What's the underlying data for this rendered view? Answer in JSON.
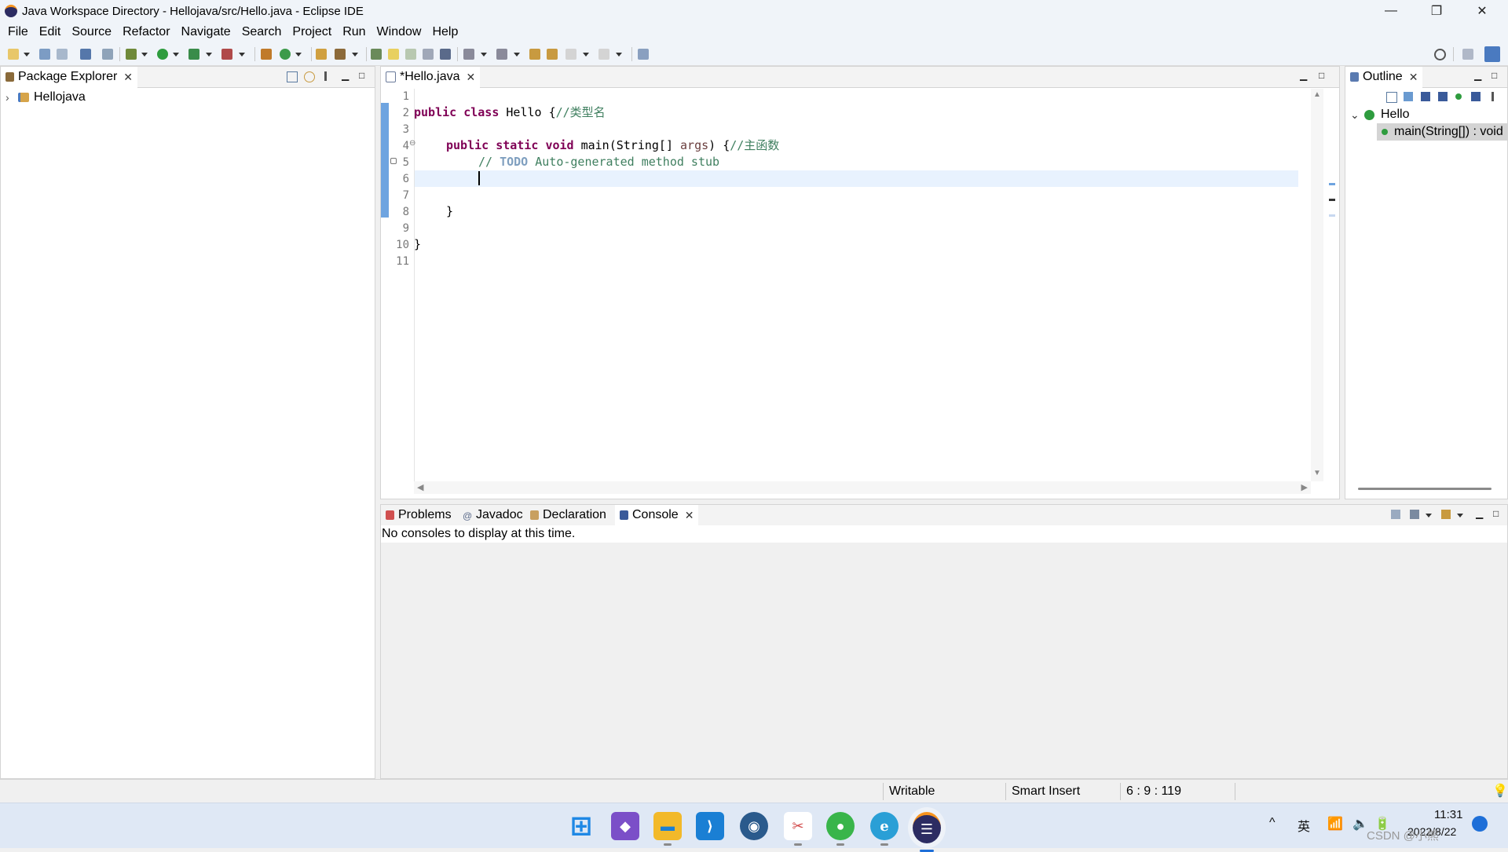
{
  "window": {
    "title": "Java Workspace Directory - Hellojava/src/Hello.java - Eclipse IDE",
    "minimize": "—",
    "restore": "❐",
    "close": "✕"
  },
  "menu": [
    "File",
    "Edit",
    "Source",
    "Refactor",
    "Navigate",
    "Search",
    "Project",
    "Run",
    "Window",
    "Help"
  ],
  "package_explorer": {
    "tab_label": "Package Explorer",
    "tree": [
      {
        "label": "Hellojava",
        "expander": "›"
      }
    ]
  },
  "editor": {
    "tab_label": "*Hello.java",
    "line_numbers": [
      "1",
      "2",
      "3",
      "4",
      "5",
      "6",
      "7",
      "8",
      "9",
      "10",
      "11"
    ],
    "fold_marker": "⊖",
    "line2": {
      "kw1": "public",
      "kw2": "class",
      "name": "Hello",
      "rest": " {",
      "comment": "//类型名"
    },
    "line4": {
      "kw1": "public",
      "kw2": "static",
      "kw3": "void",
      "sig": " main(String[] ",
      "arg": "args",
      ") {": "",
      "rest": ") {",
      "comment": "//主函数"
    },
    "line5": {
      "comment_start": "// ",
      "todo": "TODO",
      "comment_rest": " Auto-generated method stub"
    },
    "line8": "}",
    "line10": "}"
  },
  "outline": {
    "tab_label": "Outline",
    "root": {
      "label": "Hello",
      "expander": "⌄"
    },
    "child": {
      "label": "main(String[]) : void"
    }
  },
  "bottom": {
    "tabs": [
      {
        "label": "Problems"
      },
      {
        "label": "Javadoc"
      },
      {
        "label": "Declaration"
      },
      {
        "label": "Console"
      }
    ],
    "message": "No consoles to display at this time."
  },
  "status": {
    "mode": "Writable",
    "insert": "Smart Insert",
    "position": "6 : 9 : 119"
  },
  "taskbar": {
    "apps": [
      {
        "name": "windows-start",
        "label": "⊞",
        "color": "#1e88e5"
      },
      {
        "name": "visual-studio",
        "label": "◆",
        "color": "#7b4fc8"
      },
      {
        "name": "file-explorer",
        "label": "▬",
        "color": "#f2b92a"
      },
      {
        "name": "vscode",
        "label": "⟩",
        "color": "#1a7fd4"
      },
      {
        "name": "network-app",
        "label": "◉",
        "color": "#2a5a8c"
      },
      {
        "name": "snipping-tool",
        "label": "✂",
        "color": "#d14a4a"
      },
      {
        "name": "wechat",
        "label": "●",
        "color": "#39b54a"
      },
      {
        "name": "edge",
        "label": "e",
        "color": "#2a9fd6"
      },
      {
        "name": "eclipse",
        "label": "☰",
        "color": "#2c2c62"
      }
    ],
    "tray_ime": "英",
    "tray_expand": "^",
    "clock_time": "11:31",
    "clock_date": "2022/8/22",
    "watermark": "CSDN @小熊"
  }
}
